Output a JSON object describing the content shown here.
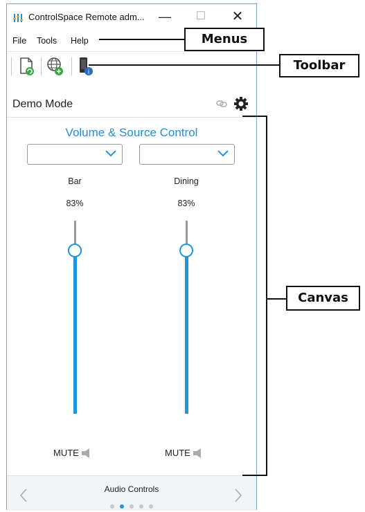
{
  "window": {
    "title": "ControlSpace Remote adm...",
    "minimize_glyph": "—",
    "maximize_glyph": "☐",
    "close_glyph": "✕"
  },
  "menu": {
    "items": [
      "File",
      "Tools",
      "Help"
    ]
  },
  "toolbar": {
    "buttons": [
      {
        "icon": "document-refresh-icon"
      },
      {
        "icon": "network-globe-icon"
      },
      {
        "icon": "device-info-icon"
      }
    ]
  },
  "header": {
    "mode_label": "Demo Mode",
    "icons": [
      "link-icon",
      "gear-icon"
    ]
  },
  "panel": {
    "title": "Volume & Source Control",
    "zones": [
      {
        "name": "Bar",
        "volume_text": "83%",
        "volume": 0.83,
        "source_value": "",
        "mute_label": "MUTE"
      },
      {
        "name": "Dining",
        "volume_text": "83%",
        "volume": 0.83,
        "source_value": "",
        "mute_label": "MUTE"
      }
    ]
  },
  "footer": {
    "page_label": "Audio Controls",
    "page_count": 5,
    "active_page": 2
  },
  "annotations": {
    "menus": "Menus",
    "toolbar": "Toolbar",
    "canvas": "Canvas"
  },
  "colors": {
    "accent": "#1f97dc",
    "title_blue": "#1f8fd5",
    "track_gray": "#9a9a9a",
    "window_border": "#7aa7d6"
  }
}
